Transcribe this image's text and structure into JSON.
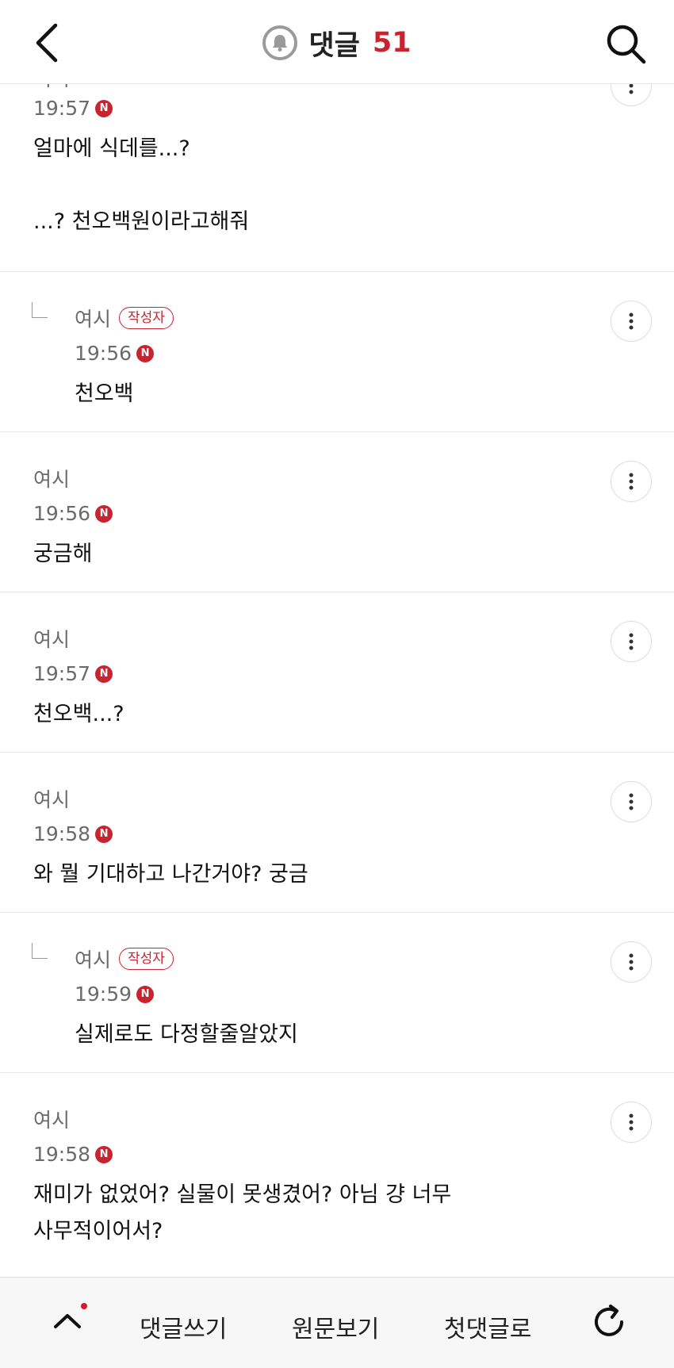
{
  "header": {
    "title": "댓글",
    "count": "51",
    "back_icon": "chevron-left-icon",
    "bell_icon": "bell-icon",
    "search_icon": "search-icon"
  },
  "comments": [
    {
      "author": "여시",
      "time": "19:57",
      "n": "N",
      "text": "얼마에 식데를...?\n\n...? 천오백원이라고해줘",
      "reply": false,
      "writer_badge": ""
    },
    {
      "author": "여시",
      "time": "19:56",
      "n": "N",
      "text": "천오백",
      "reply": true,
      "writer_badge": "작성자"
    },
    {
      "author": "여시",
      "time": "19:56",
      "n": "N",
      "text": "궁금해",
      "reply": false,
      "writer_badge": ""
    },
    {
      "author": "여시",
      "time": "19:57",
      "n": "N",
      "text": "천오백...?",
      "reply": false,
      "writer_badge": ""
    },
    {
      "author": "여시",
      "time": "19:58",
      "n": "N",
      "text": "와 뭘 기대하고 나간거야? 궁금",
      "reply": false,
      "writer_badge": ""
    },
    {
      "author": "여시",
      "time": "19:59",
      "n": "N",
      "text": "실제로도 다정할줄알았지",
      "reply": true,
      "writer_badge": "작성자"
    },
    {
      "author": "여시",
      "time": "19:58",
      "n": "N",
      "text": "재미가 없었어? 실물이 못생겼어? 아님 걍 너무\n사무적이어서?",
      "reply": false,
      "writer_badge": ""
    }
  ],
  "bottom_bar": {
    "write_label": "댓글쓰기",
    "original_label": "원문보기",
    "first_label": "첫댓글로",
    "up_icon": "chevron-up-icon",
    "refresh_icon": "refresh-icon"
  },
  "colors": {
    "accent": "#c8242f",
    "meta_text": "#6b6b6b",
    "divider": "#e8e8e8"
  }
}
